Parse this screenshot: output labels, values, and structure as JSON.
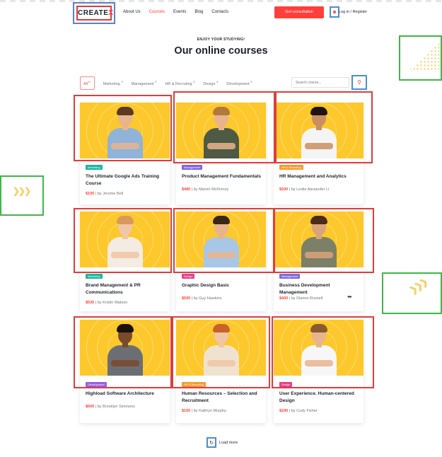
{
  "header": {
    "logo_main": "CREATE",
    "logo_x": "X",
    "nav": [
      "About Us",
      "Courses",
      "Events",
      "Blog",
      "Contacts"
    ],
    "nav_active": "Courses",
    "cta_label": "Get consultation",
    "user_icon": "person-icon",
    "login_label": "Log in / Register"
  },
  "section": {
    "eyebrow": "ENJOY YOUR STUDYING!",
    "title": "Our online courses"
  },
  "filters": {
    "items": [
      {
        "label": "All",
        "count": "17"
      },
      {
        "label": "Marketing",
        "count": "3"
      },
      {
        "label": "Management",
        "count": "3"
      },
      {
        "label": "HR & Recruting",
        "count": "3"
      },
      {
        "label": "Design",
        "count": "3"
      },
      {
        "label": "Development",
        "count": "3"
      }
    ],
    "search_placeholder": "Search course...",
    "search_icon": "search-icon"
  },
  "colors": {
    "accent": "#ff3f3a",
    "card_bg": "#fcc82c",
    "tag_marketing": "#1ab69d",
    "tag_management": "#7a6ae3",
    "tag_hr": "#f79a2e",
    "tag_design": "#e83e8c",
    "tag_development": "#9b5de5"
  },
  "courses": [
    {
      "tag": "Marketing",
      "tag_type": "marketing",
      "title": "The Ultimate Google Ads Training Course",
      "price": "$100",
      "author": "| by Jerome Bell"
    },
    {
      "tag": "Management",
      "tag_type": "management",
      "title": "Product Management Fundamentals",
      "price": "$480",
      "author": "| by Marvin McKinney"
    },
    {
      "tag": "HR & Recruting",
      "tag_type": "hr",
      "title": "HR  Management and Analytics",
      "price": "$200",
      "author": "| by Leslie Alexander Li"
    },
    {
      "tag": "Marketing",
      "tag_type": "marketing",
      "title": "Brand Management & PR Communications",
      "price": "$530",
      "author": "| by Kristin Watson"
    },
    {
      "tag": "Design",
      "tag_type": "design",
      "title": "Graphic Design Basic",
      "price": "$500",
      "author": "| by Guy Hawkins"
    },
    {
      "tag": "Management",
      "tag_type": "management",
      "title": "Business Development Management",
      "price": "$400",
      "author": "| by Dianne Russell"
    },
    {
      "tag": "Development",
      "tag_type": "development",
      "title": "Highload Software Architecture",
      "price": "$600",
      "author": "| by Brooklyn Simmons"
    },
    {
      "tag": "HR & Recruting",
      "tag_type": "hr",
      "title": "Human Resources – Selection and Recruitment",
      "price": "$150",
      "author": "| by Kathryn Murphy"
    },
    {
      "tag": "Design",
      "tag_type": "design",
      "title": "User Experience. Human-centered Design",
      "price": "$240",
      "author": "| by Cody Fisher"
    }
  ],
  "load_more": {
    "label": "Load more",
    "icon": "refresh-icon"
  }
}
